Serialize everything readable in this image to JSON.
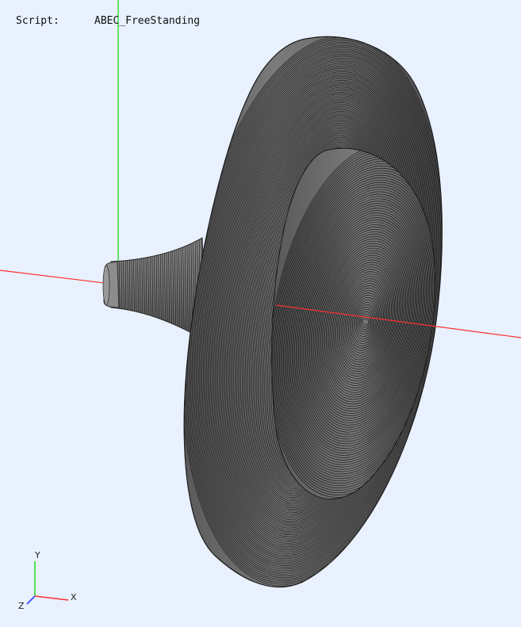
{
  "viewport": {
    "script_label": "Script:",
    "script_name": "ABEC_FreeStanding",
    "background": "#e8f1fd"
  },
  "model": {
    "icon": "horn-mesh-model",
    "fill": "#6f6f6f",
    "line_color": "#1b1b1b"
  },
  "axes": {
    "x_color": "#ff3030",
    "y_color": "#30dd30",
    "z_color": "#3040ff"
  },
  "triad": {
    "x_label": "X",
    "y_label": "Y",
    "z_label": "Z"
  }
}
